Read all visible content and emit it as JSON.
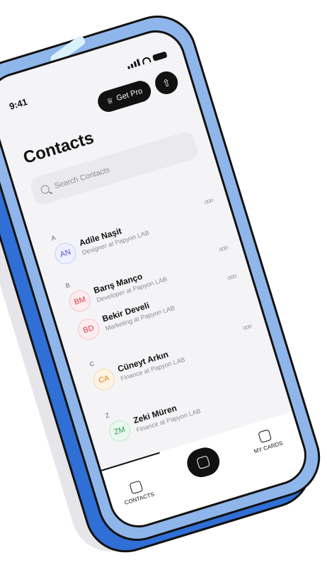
{
  "status": {
    "time": "9:41"
  },
  "header": {
    "get_pro_label": "Get Pro",
    "title": "Contacts"
  },
  "search": {
    "placeholder": "Search Contacts"
  },
  "sections": [
    {
      "letter": "A",
      "contacts": [
        {
          "initials": "AN",
          "name": "Adile Naşit",
          "role": "Designer at Papyon LAB",
          "avatar_color": "#5b4bd8",
          "avatar_bg": "#eef0ff"
        }
      ]
    },
    {
      "letter": "B",
      "contacts": [
        {
          "initials": "BM",
          "name": "Barış Manço",
          "role": "Developer at Papyon LAB",
          "avatar_color": "#d23c4a",
          "avatar_bg": "#ffecef"
        },
        {
          "initials": "BD",
          "name": "Bekir Develi",
          "role": "Marketing at Papyon LAB",
          "avatar_color": "#d23c4a",
          "avatar_bg": "#ffecef"
        }
      ]
    },
    {
      "letter": "C",
      "contacts": [
        {
          "initials": "CA",
          "name": "Cüneyt Arkın",
          "role": "Finance at Papyon LAB",
          "avatar_color": "#e07a1a",
          "avatar_bg": "#fff3e3"
        }
      ]
    },
    {
      "letter": "Z",
      "contacts": [
        {
          "initials": "ZM",
          "name": "Zeki Müren",
          "role": "Finance at Papyon LAB",
          "avatar_color": "#2f9a56",
          "avatar_bg": "#e9f9ee"
        }
      ]
    }
  ],
  "more_label": "ooo",
  "tabbar": {
    "contacts_label": "CONTACTS",
    "my_cards_label": "MY CARDS"
  },
  "colors": {
    "frame_outer": "#2f6fd6",
    "frame_inner": "#8fb6ea",
    "screen_bg": "#f4f4f7",
    "accent": "#111111"
  }
}
